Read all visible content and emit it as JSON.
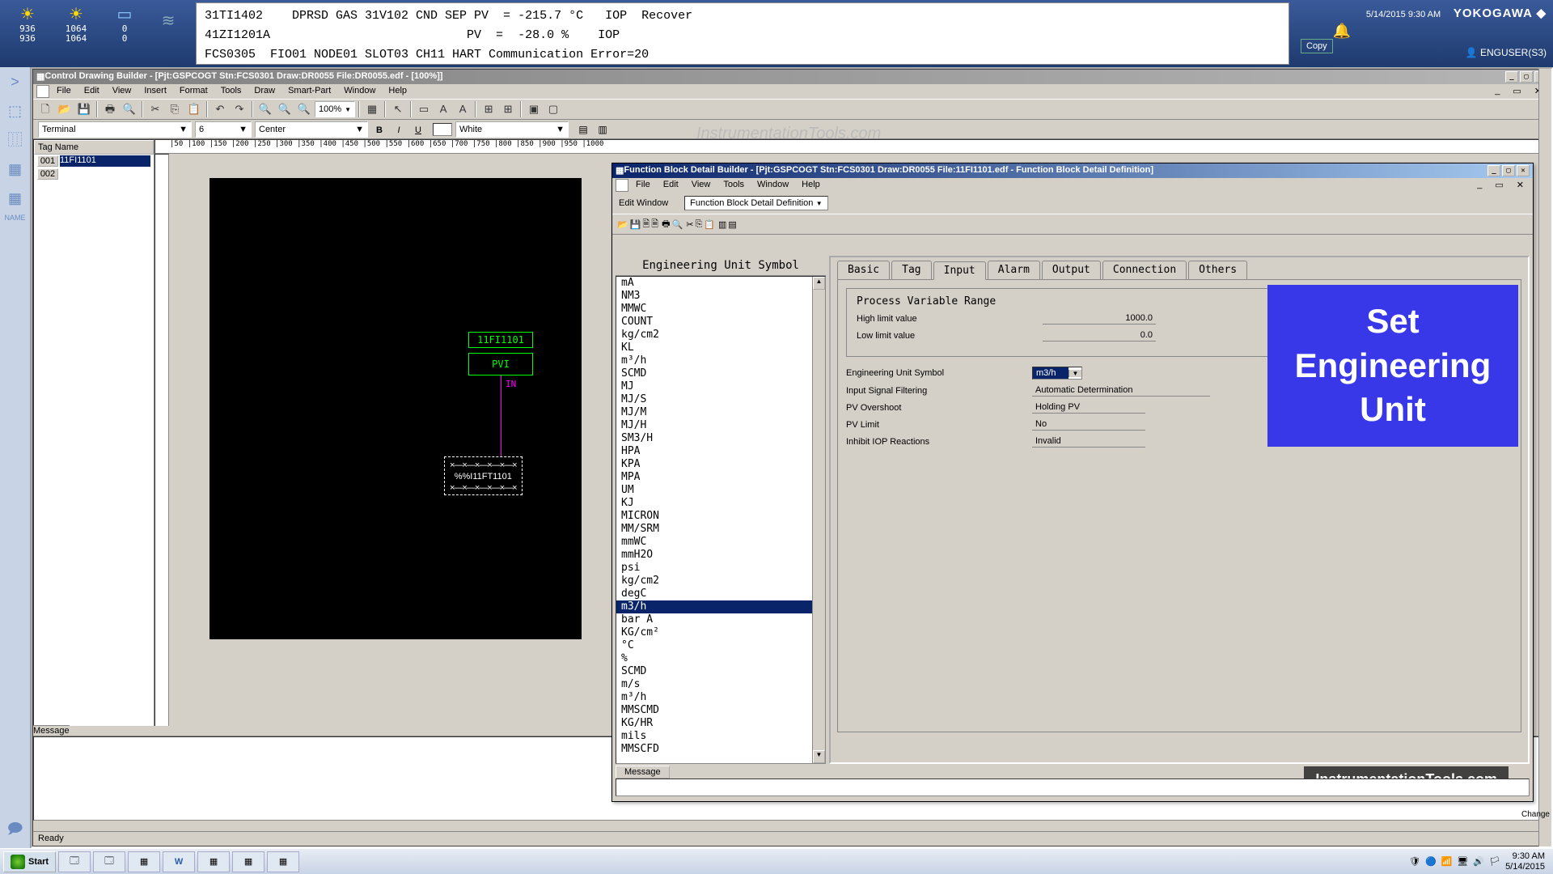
{
  "sysbar": {
    "gauges": [
      {
        "icon": "☀",
        "v1": "936",
        "v2": "936"
      },
      {
        "icon": "☀",
        "v1": "1064",
        "v2": "1064"
      },
      {
        "icon": "▭",
        "v1": "0",
        "v2": "0"
      }
    ],
    "trend_icon": "≋",
    "messages": "31TI1402    DPRSD GAS 31V102 CND SEP PV  = -215.7 °C   IOP  Recover\n41ZI1201A                           PV  =  -28.0 %    IOP\nFCS0305  FIO01 NODE01 SLOT03 CH11 HART Communication Error=20",
    "datetime": "5/14/2015 9:30 AM",
    "brand": "YOKOGAWA ◆",
    "copy": "Copy",
    "user": "👤 ENGUSER(S3)",
    "bell": "🔔"
  },
  "sidebar": {
    "items": [
      ">",
      "⬚",
      "⿲",
      "▦",
      "▦"
    ],
    "label": "NAME",
    "bottom_icon": "🗩"
  },
  "cdb": {
    "title": "Control Drawing Builder - [Pjt:GSPCOGT Stn:FCS0301 Draw:DR0055 File:DR0055.edf - [100%]]",
    "menu": [
      "File",
      "Edit",
      "View",
      "Insert",
      "Format",
      "Tools",
      "Draw",
      "Smart-Part",
      "Window",
      "Help"
    ],
    "zoom": "100%",
    "format": {
      "font": "Terminal",
      "size": "6",
      "align": "Center",
      "color": "White"
    },
    "taglist_header": "Tag Name",
    "rows": [
      {
        "n": "001",
        "v": "11FI1101",
        "sel": true
      },
      {
        "n": "002",
        "v": "",
        "sel": false
      }
    ],
    "ruler": "|50  |100  |150  |200  |250  |300  |350  |400  |450  |500  |550  |600  |650  |700  |750  |800  |850  |900  |950  |1000",
    "block_tag": "11FI1101",
    "block_type": "PVI",
    "block_port": "IN",
    "io_tag": "%%I11FT1101",
    "msg_tab": "Message",
    "status": "Ready"
  },
  "fbd": {
    "title": "Function Block Detail Builder - [Pjt:GSPCOGT Stn:FCS0301 Draw:DR0055 File:11FI1101.edf - Function Block Detail Definition]",
    "menu": [
      "File",
      "Edit",
      "View",
      "Tools",
      "Window",
      "Help"
    ],
    "edit_label": "Edit Window",
    "edit_combo": "Function Block Detail Definition",
    "unit_header": "Engineering Unit Symbol",
    "units": [
      "mA",
      "NM3",
      "MMWC",
      "COUNT",
      "kg/cm2",
      "KL",
      "m³/h",
      "SCMD",
      "MJ",
      "MJ/S",
      "MJ/M",
      "MJ/H",
      "SM3/H",
      "HPA",
      "KPA",
      "MPA",
      "UM",
      "KJ",
      "MICRON",
      "MM/SRM",
      "mmWC",
      "mmH2O",
      "psi",
      "kg/cm2",
      "degC",
      "m3/h",
      "bar A",
      "KG/cm²",
      " °C",
      " %",
      "SCMD",
      "m/s",
      " m³/h",
      "MMSCMD",
      "KG/HR",
      "mils",
      "MMSCFD"
    ],
    "selected_unit_index": 25,
    "tabs": [
      "Basic",
      "Tag",
      "Input",
      "Alarm",
      "Output",
      "Connection",
      "Others"
    ],
    "active_tab": 2,
    "pvr_legend": "Process Variable Range",
    "high_label": "High limit value",
    "high_value": "1000.0",
    "low_label": "Low limit value",
    "low_value": "0.0",
    "eus_label": "Engineering Unit Symbol",
    "eus_value": "m3/h",
    "isf_label": "Input Signal Filtering",
    "isf_value": "Automatic Determination",
    "pvo_label": "PV Overshoot",
    "pvo_value": "Holding PV",
    "pvl_label": "PV Limit",
    "pvl_value": "No",
    "iir_label": "Inhibit IOP Reactions",
    "iir_value": "Invalid",
    "msg_tab": "Message"
  },
  "annotation": "Set Engineering Unit",
  "watermark": "InstrumentationTools.com",
  "taskbar": {
    "start": "Start",
    "clock_time": "9:30 AM",
    "clock_date": "5/14/2015",
    "change": "Change"
  }
}
